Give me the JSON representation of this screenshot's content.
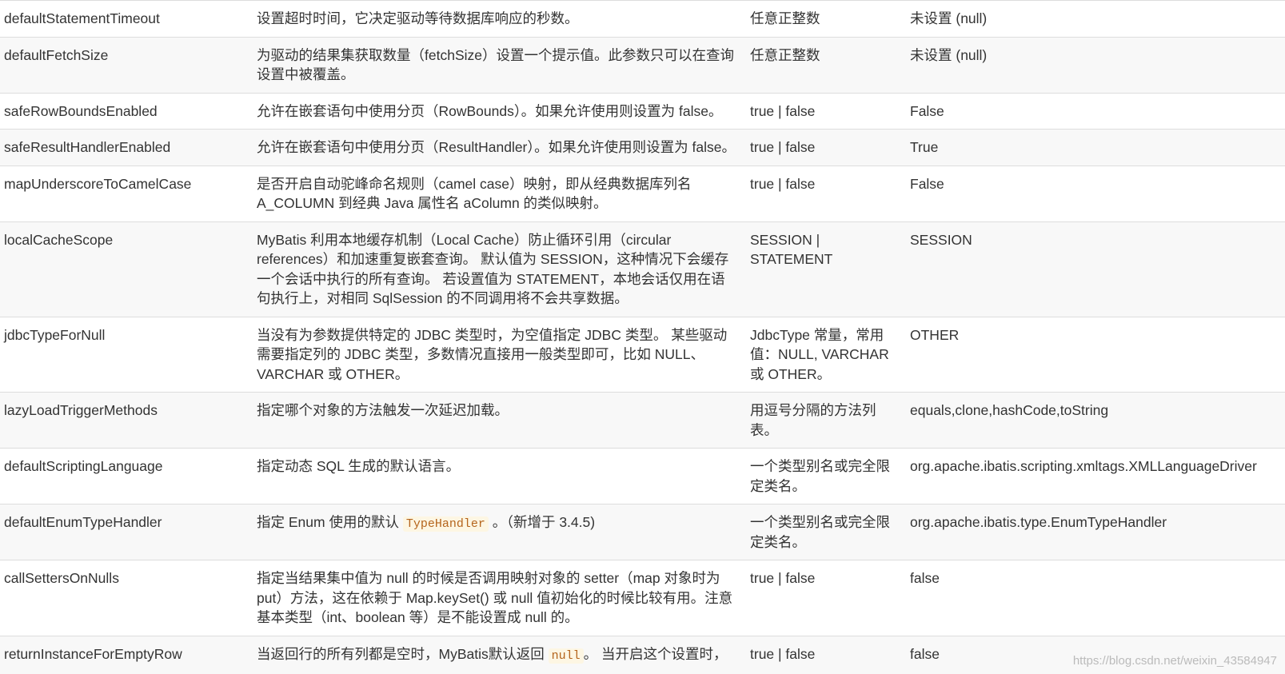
{
  "rows": [
    {
      "name": "defaultStatementTimeout",
      "desc": "设置超时时间，它决定驱动等待数据库响应的秒数。",
      "values": "任意正整数",
      "default": "未设置 (null)"
    },
    {
      "name": "defaultFetchSize",
      "desc": "为驱动的结果集获取数量（fetchSize）设置一个提示值。此参数只可以在查询设置中被覆盖。",
      "values": "任意正整数",
      "default": "未设置 (null)"
    },
    {
      "name": "safeRowBoundsEnabled",
      "desc": "允许在嵌套语句中使用分页（RowBounds）。如果允许使用则设置为 false。",
      "values": "true | false",
      "default": "False"
    },
    {
      "name": "safeResultHandlerEnabled",
      "desc": "允许在嵌套语句中使用分页（ResultHandler）。如果允许使用则设置为 false。",
      "values": "true | false",
      "default": "True"
    },
    {
      "name": "mapUnderscoreToCamelCase",
      "desc": "是否开启自动驼峰命名规则（camel case）映射，即从经典数据库列名 A_COLUMN 到经典 Java 属性名 aColumn 的类似映射。",
      "values": "true | false",
      "default": "False"
    },
    {
      "name": "localCacheScope",
      "desc": "MyBatis 利用本地缓存机制（Local Cache）防止循环引用（circular references）和加速重复嵌套查询。 默认值为 SESSION，这种情况下会缓存一个会话中执行的所有查询。 若设置值为 STATEMENT，本地会话仅用在语句执行上，对相同 SqlSession 的不同调用将不会共享数据。",
      "values": "SESSION | STATEMENT",
      "default": "SESSION"
    },
    {
      "name": "jdbcTypeForNull",
      "desc": "当没有为参数提供特定的 JDBC 类型时，为空值指定 JDBC 类型。 某些驱动需要指定列的 JDBC 类型，多数情况直接用一般类型即可，比如 NULL、VARCHAR 或 OTHER。",
      "values": "JdbcType 常量，常用值：NULL, VARCHAR 或 OTHER。",
      "default": "OTHER"
    },
    {
      "name": "lazyLoadTriggerMethods",
      "desc": "指定哪个对象的方法触发一次延迟加载。",
      "values": "用逗号分隔的方法列表。",
      "default": "equals,clone,hashCode,toString"
    },
    {
      "name": "defaultScriptingLanguage",
      "desc": "指定动态 SQL 生成的默认语言。",
      "values": "一个类型别名或完全限定类名。",
      "default": "org.apache.ibatis.scripting.xmltags.XMLLanguageDriver"
    },
    {
      "name": "defaultEnumTypeHandler",
      "desc_pre": "指定 Enum 使用的默认 ",
      "desc_code": "TypeHandler",
      "desc_post": " 。（新增于 3.4.5)",
      "values": "一个类型别名或完全限定类名。",
      "default": "org.apache.ibatis.type.EnumTypeHandler"
    },
    {
      "name": "callSettersOnNulls",
      "desc": "指定当结果集中值为 null 的时候是否调用映射对象的 setter（map 对象时为 put）方法，这在依赖于 Map.keySet() 或 null 值初始化的时候比较有用。注意基本类型（int、boolean 等）是不能设置成 null 的。",
      "values": "true | false",
      "default": "false"
    },
    {
      "name": "returnInstanceForEmptyRow",
      "desc_pre": "当返回行的所有列都是空时，MyBatis默认返回 ",
      "desc_code": "null",
      "desc_post": "。 当开启这个设置时，",
      "values": "true | false",
      "default": "false"
    }
  ],
  "watermark": "https://blog.csdn.net/weixin_43584947"
}
